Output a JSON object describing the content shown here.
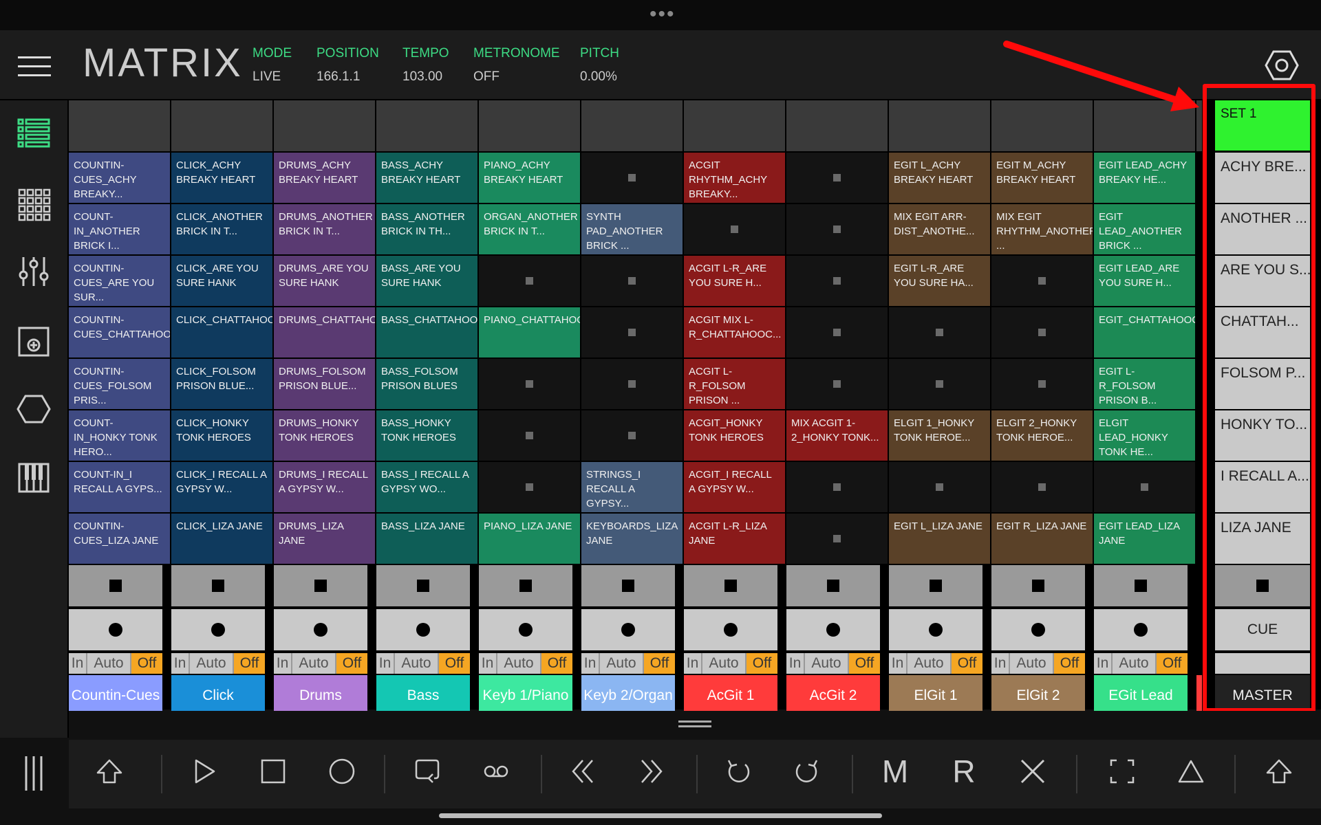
{
  "app": {
    "title": "MATRIX"
  },
  "header": {
    "stats": [
      {
        "label": "MODE",
        "value": "LIVE"
      },
      {
        "label": "POSITION",
        "value": "166.1.1"
      },
      {
        "label": "TEMPO",
        "value": "103.00"
      },
      {
        "label": "METRONOME",
        "value": "OFF"
      },
      {
        "label": "PITCH",
        "value": "0.00%"
      }
    ]
  },
  "monitor": {
    "in": "In",
    "auto": "Auto",
    "off": "Off"
  },
  "tracks": [
    {
      "name": "Countin-Cues",
      "color": "#8a9cff",
      "cell": "#3f4a82",
      "text": "#ffffff"
    },
    {
      "name": "Click",
      "color": "#1a8fd8",
      "cell": "#0f3a5e",
      "text": "#ffffff"
    },
    {
      "name": "Drums",
      "color": "#b07cd8",
      "cell": "#5a3a72",
      "text": "#ffffff"
    },
    {
      "name": "Bass",
      "color": "#14c7b3",
      "cell": "#0e5e57",
      "text": "#ffffff"
    },
    {
      "name": "Keyb 1/Piano",
      "color": "#3de8a0",
      "cell": "#1a8a5e",
      "text": "#ffffff"
    },
    {
      "name": "Keyb 2/Organ",
      "color": "#8bb6f2",
      "cell": "#445a78",
      "text": "#ffffff"
    },
    {
      "name": "AcGit 1",
      "color": "#ff3b3b",
      "cell": "#8a1a1a",
      "text": "#ffffff"
    },
    {
      "name": "AcGit 2",
      "color": "#ff3b3b",
      "cell": "#8a1a1a",
      "text": "#ffffff"
    },
    {
      "name": "ElGit 1",
      "color": "#9c7a55",
      "cell": "#5a4128",
      "text": "#ffffff"
    },
    {
      "name": "ElGit 2",
      "color": "#9c7a55",
      "cell": "#5a4128",
      "text": "#ffffff"
    },
    {
      "name": "EGit Lead",
      "color": "#36e08a",
      "cell": "#1c8a55",
      "text": "#ffffff"
    }
  ],
  "clips": [
    [
      "COUNTIN-CUES_ACHY BREAKY...",
      "CLICK_ACHY BREAKY HEART",
      "DRUMS_ACHY BREAKY HEART",
      "BASS_ACHY BREAKY HEART",
      "PIANO_ACHY BREAKY HEART",
      "",
      "ACGIT RHYTHM_ACHY BREAKY...",
      "",
      "EGIT L_ACHY BREAKY HEART",
      "EGIT M_ACHY BREAKY HEART",
      "EGIT LEAD_ACHY BREAKY HE..."
    ],
    [
      "COUNT-IN_ANOTHER BRICK I...",
      "CLICK_ANOTHER BRICK IN T...",
      "DRUMS_ANOTHER BRICK IN T...",
      "BASS_ANOTHER BRICK IN TH...",
      "ORGAN_ANOTHER BRICK IN T...",
      "SYNTH PAD_ANOTHER BRICK ...",
      "",
      "",
      "MIX EGIT ARR-DIST_ANOTHE...",
      "MIX EGIT RHYTHM_ANOTHER ...",
      "EGIT LEAD_ANOTHER BRICK ..."
    ],
    [
      "COUNTIN-CUES_ARE YOU SUR...",
      "CLICK_ARE YOU SURE HANK",
      "DRUMS_ARE YOU SURE HANK",
      "BASS_ARE YOU SURE HANK",
      "",
      "",
      "ACGIT L-R_ARE YOU SURE H...",
      "",
      "EGIT L-R_ARE YOU SURE HA...",
      "",
      "EGIT LEAD_ARE YOU SURE H..."
    ],
    [
      "COUNTIN-CUES_CHATTAHOOCH...",
      "CLICK_CHATTAHOOCHEE",
      "DRUMS_CHATTAHOOCHEE",
      "BASS_CHATTAHOOCHEE",
      "PIANO_CHATTAHOOCHEE",
      "",
      "ACGIT MIX L-R_CHATTAHOOC...",
      "",
      "",
      "",
      "EGIT_CHATTAHOOCHEE"
    ],
    [
      "COUNTIN-CUES_FOLSOM PRIS...",
      "CLICK_FOLSOM PRISON BLUE...",
      "DRUMS_FOLSOM PRISON BLUE...",
      "BASS_FOLSOM PRISON BLUES",
      "",
      "",
      "ACGIT L-R_FOLSOM PRISON ...",
      "",
      "",
      "",
      "EGIT L-R_FOLSOM PRISON B..."
    ],
    [
      "COUNT-IN_HONKY TONK HERO...",
      "CLICK_HONKY TONK HEROES",
      "DRUMS_HONKY TONK HEROES",
      "BASS_HONKY TONK HEROES",
      "",
      "",
      "ACGIT_HONKY TONK HEROES",
      "MIX ACGIT 1-2_HONKY TONK...",
      "ELGIT 1_HONKY TONK HEROE...",
      "ELGIT 2_HONKY TONK HEROE...",
      "ELGIT LEAD_HONKY TONK HE..."
    ],
    [
      "COUNT-IN_I RECALL A GYPS...",
      "CLICK_I RECALL A GYPSY W...",
      "DRUMS_I RECALL A GYPSY W...",
      "BASS_I RECALL A GYPSY WO...",
      "",
      "STRINGS_I RECALL A GYPSY...",
      "ACGIT_I RECALL A GYPSY W...",
      "",
      "",
      "",
      ""
    ],
    [
      "COUNTIN-CUES_LIZA JANE",
      "CLICK_LIZA JANE",
      "DRUMS_LIZA JANE",
      "BASS_LIZA JANE",
      "PIANO_LIZA JANE",
      "KEYBOARDS_LIZA JANE",
      "ACGIT L-R_LIZA JANE",
      "",
      "EGIT L_LIZA JANE",
      "EGIT R_LIZA JANE",
      "EGIT LEAD_LIZA JANE"
    ]
  ],
  "scenes": {
    "set": "SET 1",
    "rows": [
      "ACHY BRE...",
      "ANOTHER ...",
      "ARE YOU S...",
      "CHATTAH...",
      "FOLSOM P...",
      "HONKY TO...",
      "I RECALL A...",
      "LIZA JANE"
    ],
    "cue": "CUE",
    "master": "MASTER"
  },
  "transport": {
    "mute_letter": "M",
    "record_letter": "R"
  },
  "colors": {
    "accent": "#3ddc84",
    "set_green": "#2ff22f",
    "annotation_red": "#ff0a0a",
    "monitor_off": "#f5a623"
  }
}
